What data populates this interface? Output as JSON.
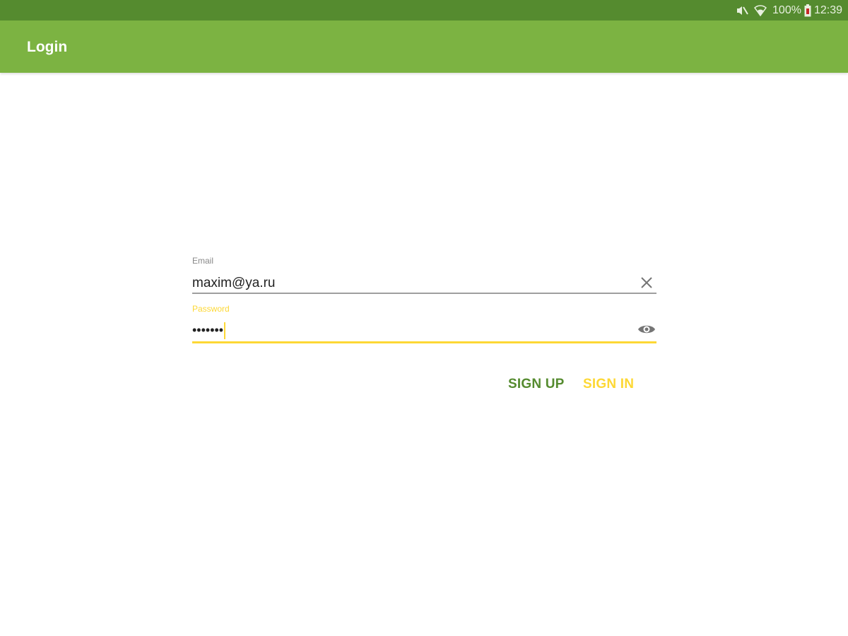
{
  "status_bar": {
    "mute_icon": "mute-icon",
    "wifi_icon": "wifi-icon",
    "battery_text": "100%",
    "battery_icon": "battery-icon",
    "time": "12:39"
  },
  "app_bar": {
    "title": "Login"
  },
  "form": {
    "email": {
      "label": "Email",
      "value": "maxim@ya.ru",
      "trailing_icon": "clear-icon"
    },
    "password": {
      "label": "Password",
      "value": "•••••••",
      "trailing_icon": "eye-icon"
    }
  },
  "actions": {
    "sign_up": "SIGN UP",
    "sign_in": "SIGN IN"
  },
  "colors": {
    "status_bar": "#558b2f",
    "app_bar": "#7cb342",
    "accent": "#fdd835",
    "secondary_button": "#558b2f"
  }
}
